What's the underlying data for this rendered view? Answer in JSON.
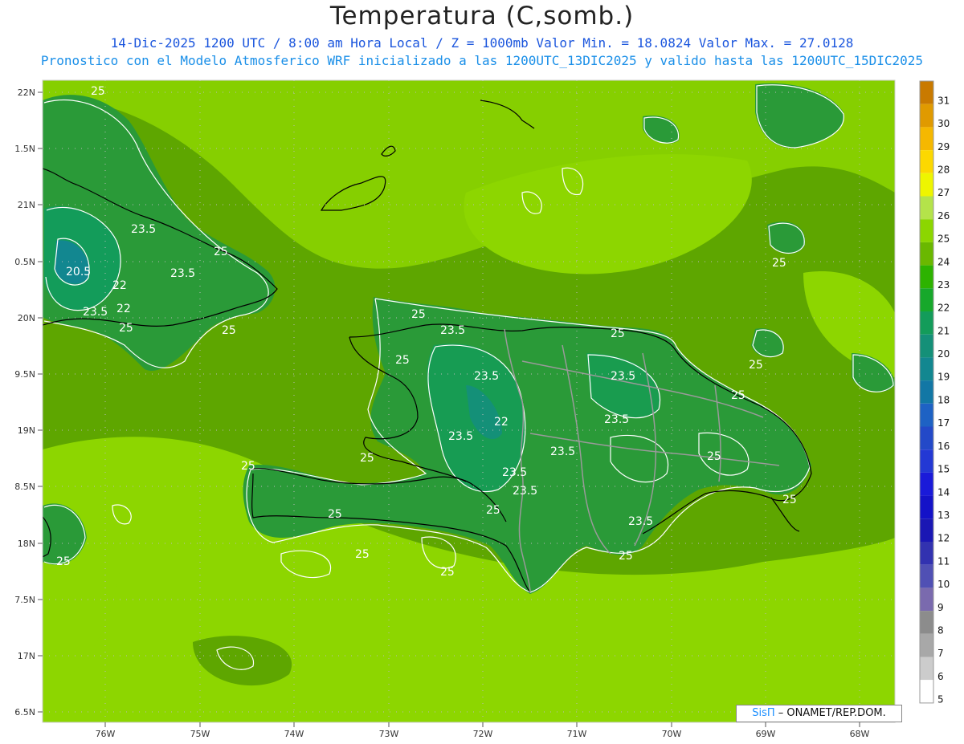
{
  "title": "Temperatura (C,somb.)",
  "subtitle_line1": "14-Dic-2025  1200 UTC / 8:00 am Hora Local / Z = 1000mb   Valor Min. = 18.0824  Valor Max. = 27.0128",
  "subtitle_line2": "Pronostico con el Modelo Atmosferico WRF inicializado a las 1200UTC_13DIC2025 y valido hasta las  1200UTC_15DIC2025",
  "credit": {
    "brand": "SisΠ",
    "text": " – ONAMET/REP.DOM."
  },
  "lat_labels": [
    "22N",
    "1.5N",
    "21N",
    "0.5N",
    "20N",
    "9.5N",
    "19N",
    "8.5N",
    "18N",
    "7.5N",
    "17N",
    "6.5N"
  ],
  "lon_labels": [
    "76W",
    "75W",
    "74W",
    "73W",
    "72W",
    "71W",
    "70W",
    "69W",
    "68W"
  ],
  "contour_labels": [
    "25",
    "23.5",
    "20.5",
    "22",
    "23.5",
    "22",
    "23.5",
    "25",
    "25",
    "25",
    "25",
    "23.5",
    "25",
    "23.5",
    "25",
    "23.5",
    "22",
    "23.5",
    "23.5",
    "25",
    "23.5",
    "25",
    "23.5",
    "23.5",
    "25",
    "25",
    "25",
    "23.5",
    "25",
    "25",
    "25",
    "25",
    "25",
    "25",
    "25",
    "25"
  ],
  "colorbar": {
    "labels": [
      "31",
      "30",
      "29",
      "28",
      "27",
      "26",
      "25",
      "24",
      "23",
      "22",
      "21",
      "20",
      "19",
      "18",
      "17",
      "16",
      "15",
      "14",
      "13",
      "12",
      "11",
      "10",
      "9",
      "8",
      "7",
      "6",
      "5"
    ],
    "colors": [
      "#c97a00",
      "#e09a00",
      "#f5b800",
      "#fcd800",
      "#eef500",
      "#b4e34a",
      "#8cd600",
      "#6ab800",
      "#2db300",
      "#17a82b",
      "#139c5a",
      "#149078",
      "#128790",
      "#1277a5",
      "#1e62c4",
      "#2349c8",
      "#2338d4",
      "#1a1ad9",
      "#1412c8",
      "#1a17b4",
      "#3232b0",
      "#5050b4",
      "#7a6aae",
      "#8c8c8c",
      "#a8a8a8",
      "#cccccc",
      "#ffffff"
    ]
  },
  "colors": {
    "sea": "#5ea600",
    "sea_light": "#8dd600",
    "land": "#2a9a38",
    "highland": "#139c5a",
    "contour": "#ffffff",
    "coast": "#000000",
    "border": "#999999"
  }
}
